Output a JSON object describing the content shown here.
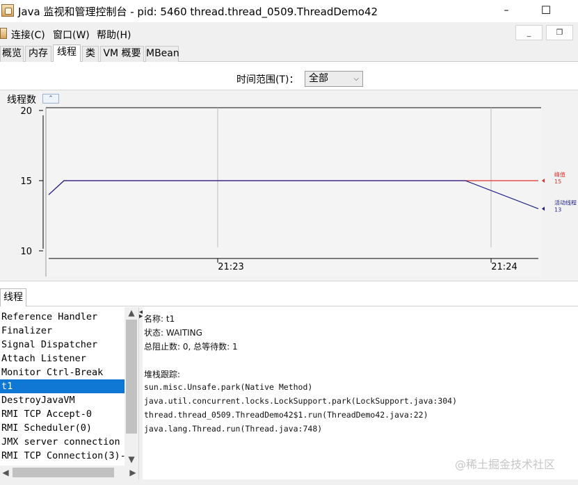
{
  "window": {
    "title": "Java 监视和管理控制台 - pid: 5460 thread.thread_0509.ThreadDemo42",
    "minimize": "–",
    "maximize": "☐"
  },
  "menu": {
    "items": [
      "连接(C)",
      "窗口(W)",
      "帮助(H)"
    ],
    "mdi_minimize": "_",
    "mdi_restore": "❐"
  },
  "tabs": [
    "概览",
    "内存",
    "线程",
    "类",
    "VM 概要",
    "MBean"
  ],
  "active_tab": "线程",
  "time_range": {
    "label": "时间范围(T)：",
    "value": "全部"
  },
  "chart": {
    "title": "线程数",
    "collapse_glyph": "⌃"
  },
  "chart_data": {
    "type": "line",
    "x_ticks": [
      "21:23",
      "21:24"
    ],
    "y_ticks": [
      10,
      15,
      20
    ],
    "ylim": [
      10,
      20
    ],
    "series": [
      {
        "name": "峰值",
        "color": "#e0322b",
        "values": [
          14,
          15,
          15,
          15,
          15
        ],
        "last": "15"
      },
      {
        "name": "活动线程",
        "color": "#1e1e8a",
        "values": [
          14,
          15,
          15,
          15,
          13
        ],
        "last": "13"
      }
    ],
    "grid": true,
    "legend": "right"
  },
  "threads_panel": {
    "tab": "线程",
    "items": [
      "Reference Handler",
      "Finalizer",
      "Signal Dispatcher",
      "Attach Listener",
      "Monitor Ctrl-Break",
      "t1",
      "DestroyJavaVM",
      "RMI TCP Accept-0",
      "RMI Scheduler(0)",
      "JMX server connection",
      "RMI TCP Connection(3)-"
    ],
    "selected": "t1"
  },
  "details": {
    "name_line": "名称: t1",
    "state_line": "状态: WAITING",
    "counts_line": "总阻止数: 0, 总等待数: 1",
    "stack_header": "堆栈跟踪:",
    "stack": [
      "sun.misc.Unsafe.park(Native Method)",
      "java.util.concurrent.locks.LockSupport.park(LockSupport.java:304)",
      "thread.thread_0509.ThreadDemo42$1.run(ThreadDemo42.java:22)",
      "java.lang.Thread.run(Thread.java:748)"
    ]
  },
  "watermark": "@稀土掘金技术社区"
}
